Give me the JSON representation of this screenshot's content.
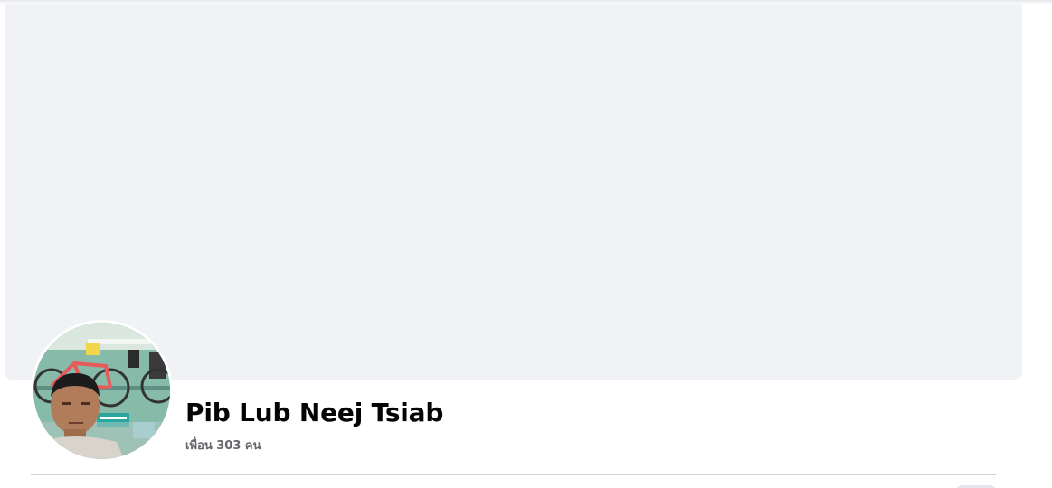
{
  "profile": {
    "name": "Pib Lub Neej Tsiab",
    "friends_text": "เพื่อน 303 คน"
  },
  "icons": {
    "avatar": "profile-photo"
  },
  "colors": {
    "cover_bg": "#f0f2f5",
    "name_text": "#050505",
    "secondary_text": "#65676b",
    "divider": "#ced0d4"
  }
}
